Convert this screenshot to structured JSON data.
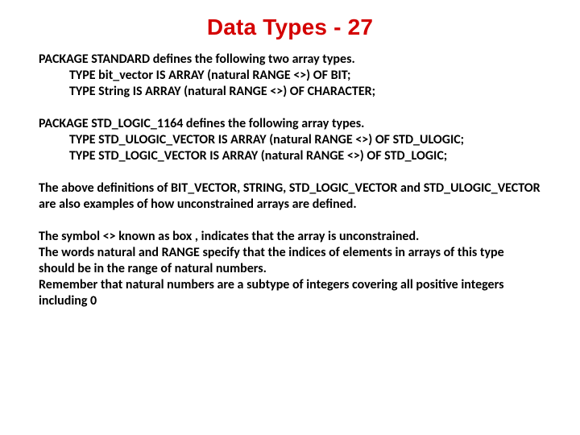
{
  "title": "Data Types - 27",
  "p1": {
    "l1": "PACKAGE STANDARD defines the following two array types.",
    "l2": "TYPE bit_vector IS ARRAY (natural  RANGE <>) OF BIT;",
    "l3": "TYPE String        IS ARRAY (natural RANGE <>) OF CHARACTER;"
  },
  "p2": {
    "l1": "PACKAGE STD_LOGIC_1164 defines the following array types.",
    "l2": "TYPE STD_ULOGIC_VECTOR IS ARRAY (natural  RANGE <>) OF STD_ULOGIC;",
    "l3": "TYPE STD_LOGIC_VECTOR IS ARRAY (natural  RANGE <>) OF STD_LOGIC;"
  },
  "p3": "The above definitions of BIT_VECTOR, STRING, STD_LOGIC_VECTOR and STD_ULOGIC_VECTOR are also examples of how unconstrained arrays are defined.",
  "p4": {
    "l1": "The symbol <> known as box , indicates that the array is unconstrained.",
    "l2": "The words natural and RANGE specify that the indices of elements in arrays of this type should be in the range of natural numbers.",
    "l3": "Remember that natural numbers are a subtype of integers covering all positive integers including 0"
  }
}
